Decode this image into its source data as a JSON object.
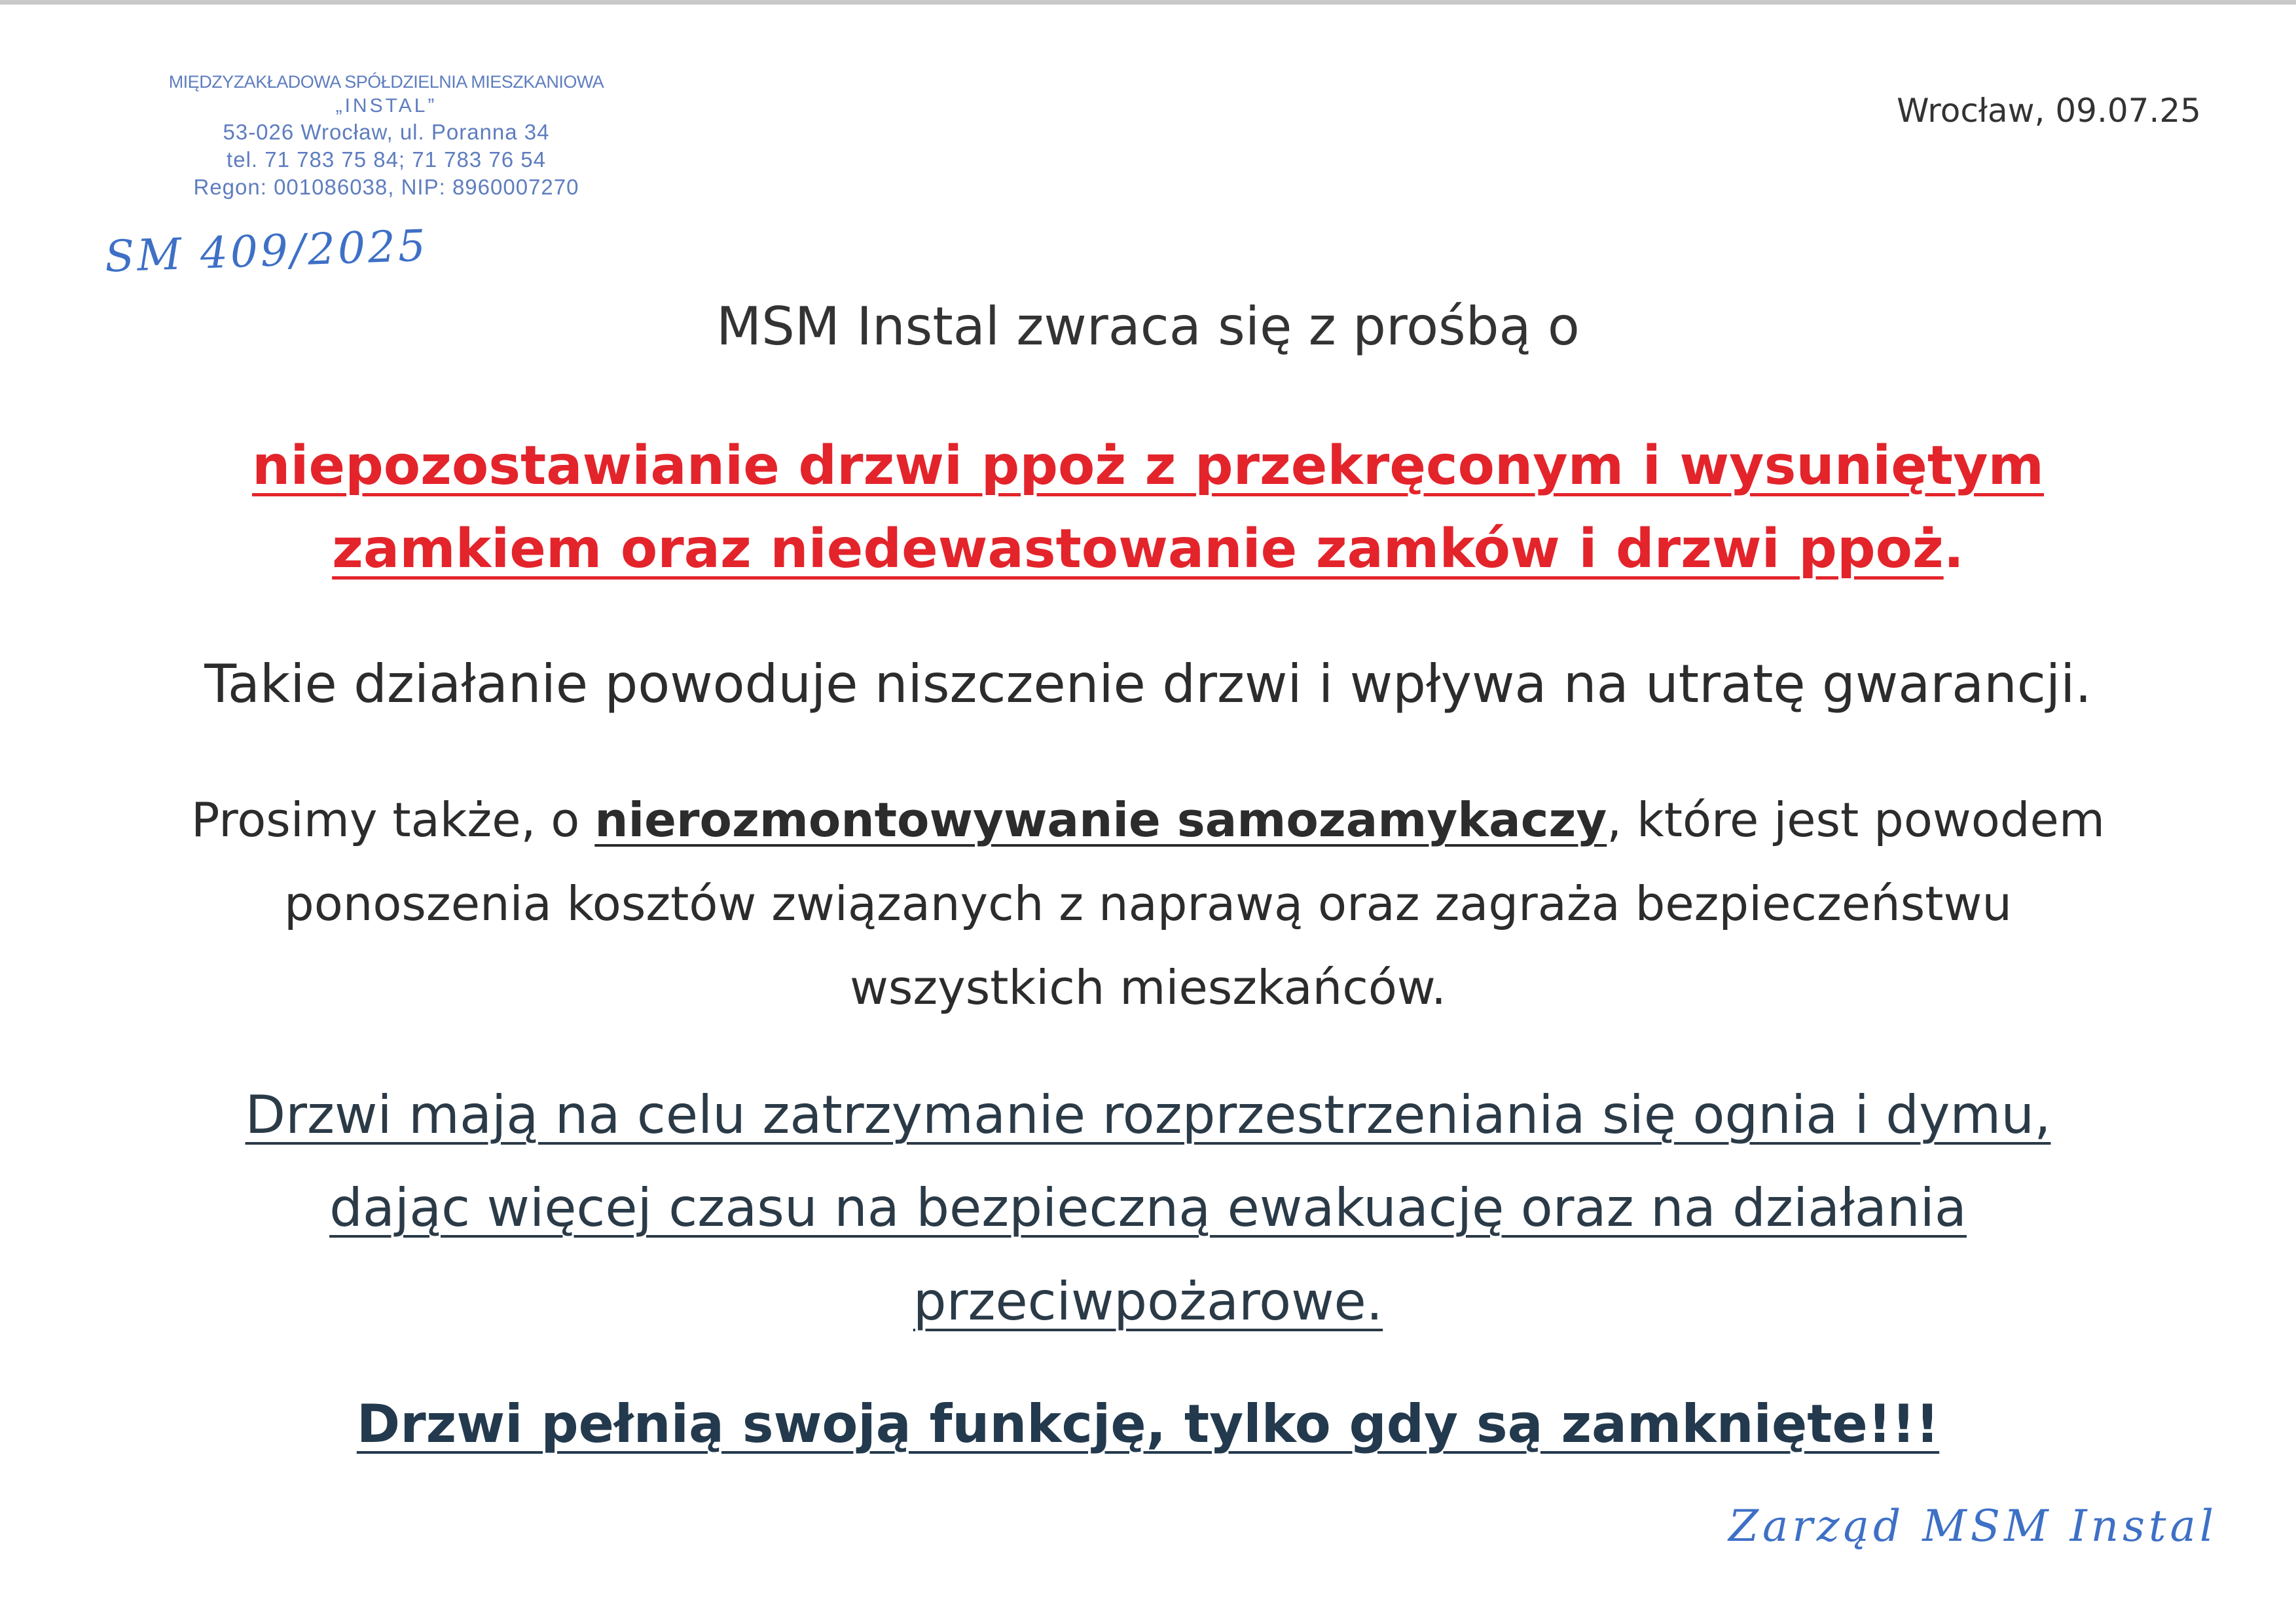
{
  "stamp": {
    "line1": "MIĘDZYZAKŁADOWA SPÓŁDZIELNIA MIESZKANIOWA",
    "line2": "„INSTAL”",
    "line3": "53-026 Wrocław, ul. Poranna 34",
    "line4": "tel. 71 783 75 84; 71 783 76 54",
    "line5": "Regon: 001086038, NIP: 8960007270"
  },
  "reference_handwritten": "SM 409/2025",
  "date": "Wrocław, 09.07.25",
  "intro": "MSM Instal zwraca się z prośbą o",
  "alert": {
    "line1": "niepozostawianie drzwi ppoż z przekręconym i wysuniętym",
    "line2": "zamkiem oraz niedewastowanie zamków i drzwi ppoż",
    "end": "."
  },
  "consequence": "Takie działanie powoduje niszczenie drzwi i wpływa na utratę gwarancji.",
  "request": {
    "before": "Prosimy także, o ",
    "bold": "nierozmontowywanie samozamykaczy",
    "after": ", które jest powodem",
    "line2": "ponoszenia kosztów związanych z naprawą oraz zagraża bezpieczeństwu",
    "line3": "wszystkich mieszkańców."
  },
  "purpose": {
    "line1": "Drzwi mają na celu zatrzymanie rozprzestrzeniania się ognia i dymu,",
    "line2": "dając więcej czasu na bezpieczną ewakuację oraz na działania",
    "line3": "przeciwpożarowe."
  },
  "closing": "Drzwi pełnią swoją funkcję, tylko gdy są zamknięte!!!",
  "signature": "Zarząd MSM Instal",
  "colors": {
    "alert_red": "#e3242b",
    "stamp_blue": "#5e7dbf",
    "ink_blue": "#3e70c6",
    "heading_dark": "#23394d"
  }
}
